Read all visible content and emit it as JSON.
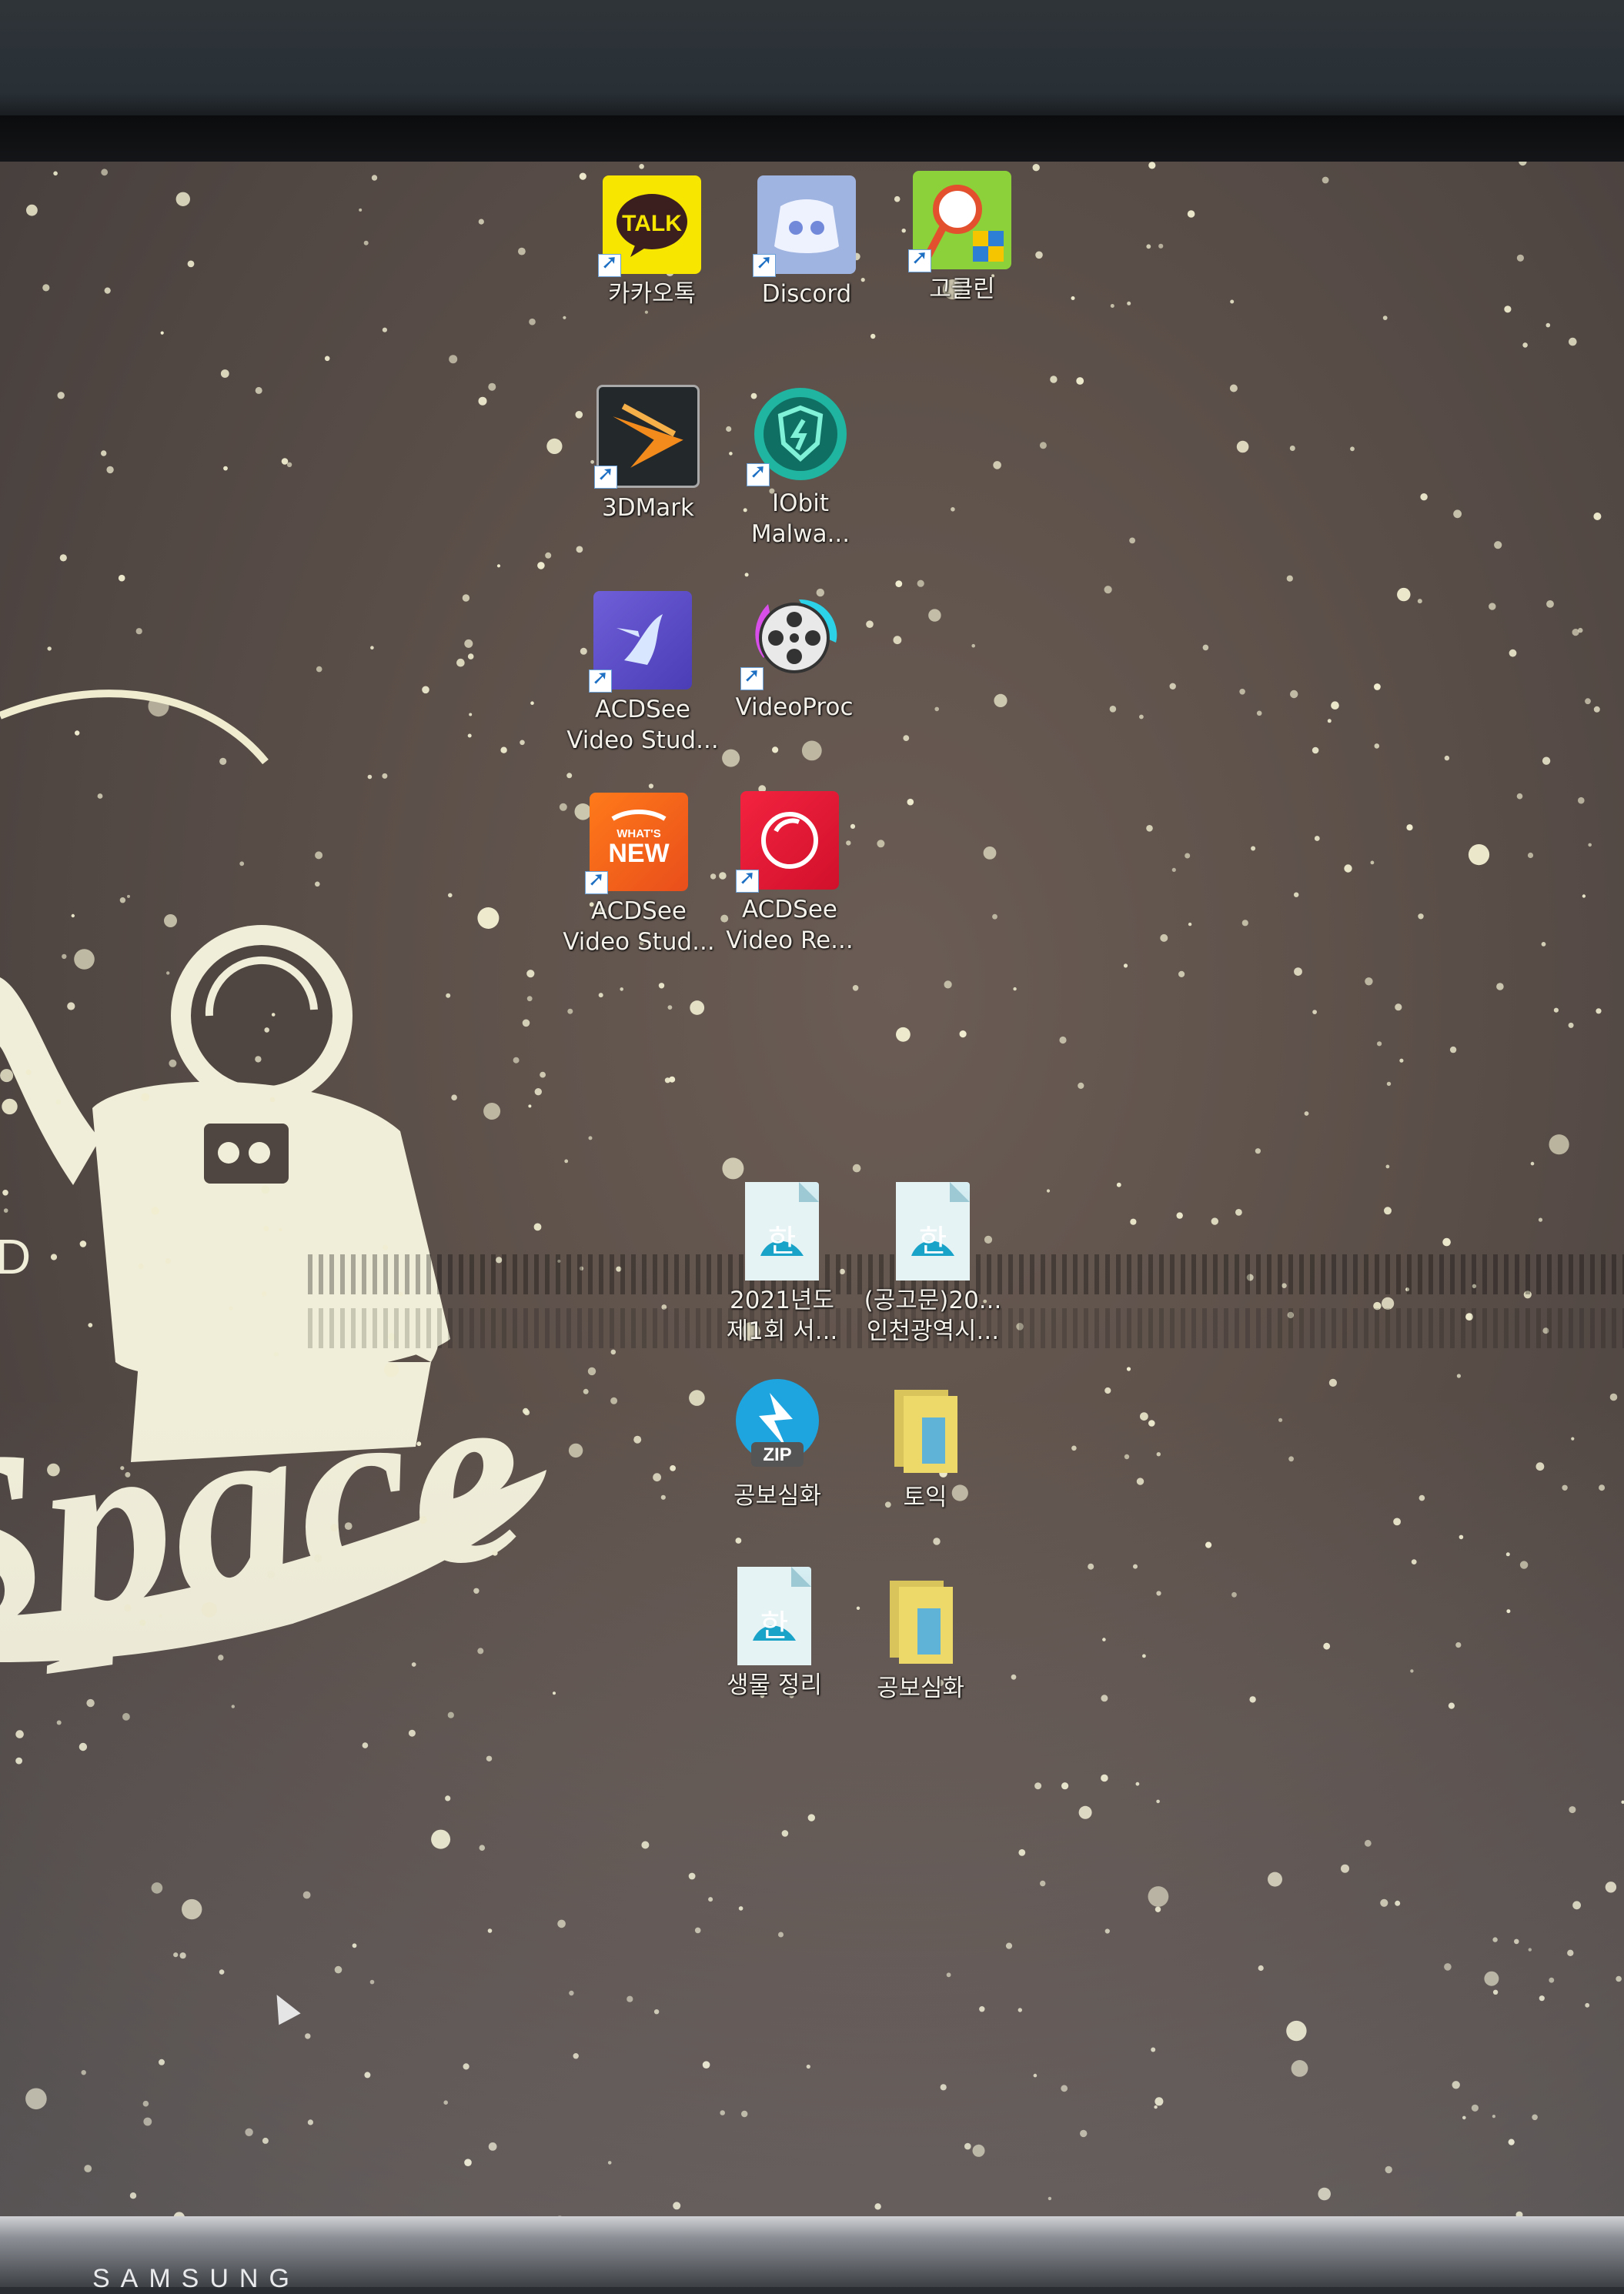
{
  "monitor": {
    "brand": "SAMSUNG"
  },
  "wallpaper": {
    "word": "Space",
    "side_letter": "D",
    "colors": {
      "background": "#5a4e48",
      "artwork": "#f0eed8"
    }
  },
  "desktop_icons": [
    {
      "label": "카카오톡",
      "icon": "kakaotalk-icon",
      "shortcut": true
    },
    {
      "label": "Discord",
      "icon": "discord-icon",
      "shortcut": true
    },
    {
      "label": "고클린",
      "icon": "goclean-icon",
      "shortcut": true
    },
    {
      "label": "3DMark",
      "icon": "3dmark-icon",
      "shortcut": true
    },
    {
      "label": "IObit\nMalwa...",
      "icon": "iobit-malware-fighter-icon",
      "shortcut": true
    },
    {
      "label": "ACDSee\nVideo Stud...",
      "icon": "acdsee-video-studio-icon",
      "shortcut": true
    },
    {
      "label": "VideoProc",
      "icon": "videoproc-icon",
      "shortcut": true
    },
    {
      "label": "ACDSee\nVideo Stud...",
      "icon": "acdsee-whats-new-icon",
      "shortcut": true
    },
    {
      "label": "ACDSee\nVideo Re...",
      "icon": "acdsee-video-recorder-icon",
      "shortcut": true
    },
    {
      "label": "2021년도\n제1회 서...",
      "icon": "hwp-document-icon",
      "shortcut": false
    },
    {
      "label": "(공고문)20...\n인천광역시...",
      "icon": "hwp-document-icon",
      "shortcut": false
    },
    {
      "label": "공보심화",
      "icon": "zip-archive-icon",
      "shortcut": false
    },
    {
      "label": "토익",
      "icon": "folder-icon",
      "shortcut": false
    },
    {
      "label": "생물 정리",
      "icon": "hwp-document-icon",
      "shortcut": false
    },
    {
      "label": "공보심화",
      "icon": "folder-icon",
      "shortcut": false
    }
  ]
}
